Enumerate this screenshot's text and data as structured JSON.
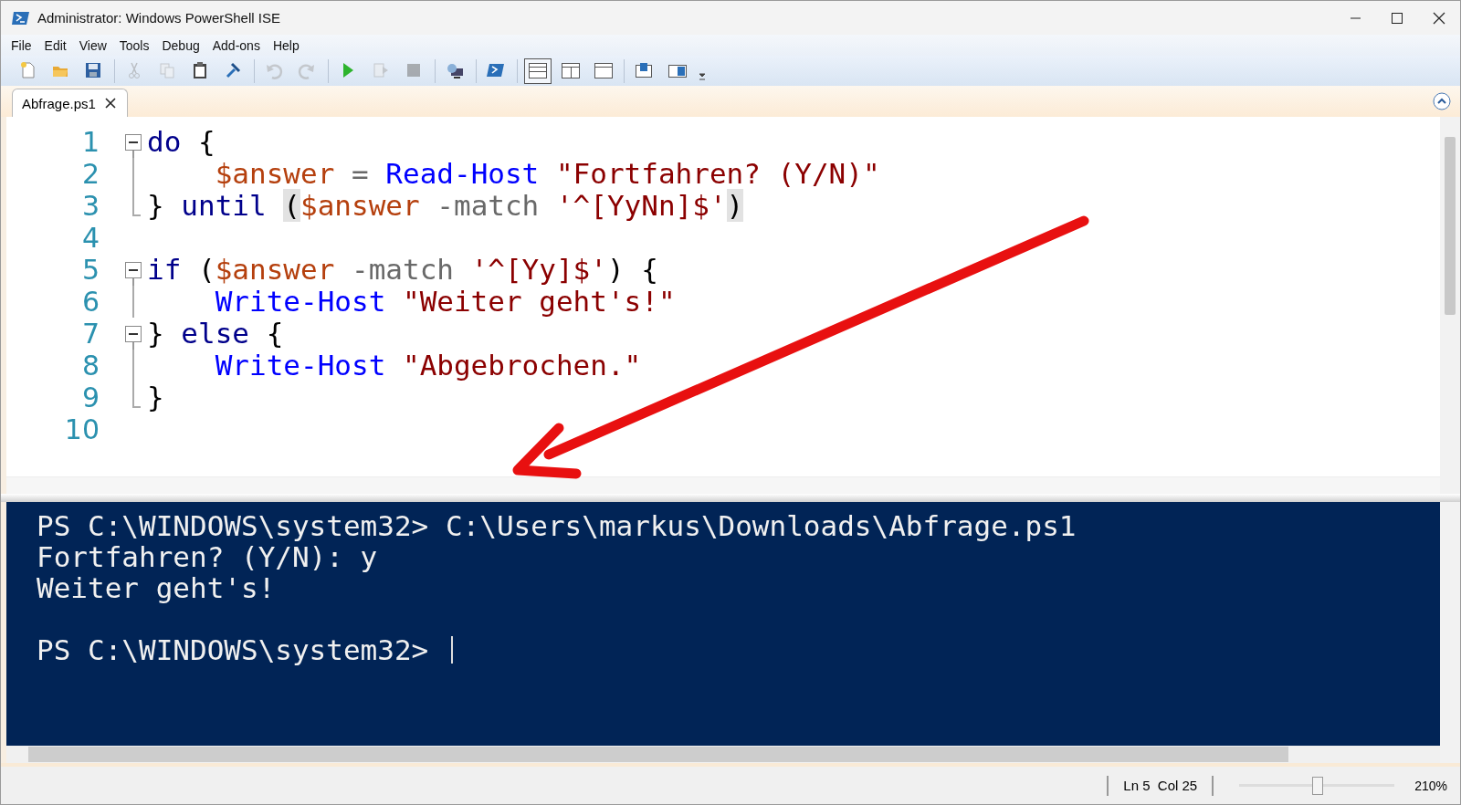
{
  "window": {
    "title": "Administrator: Windows PowerShell ISE"
  },
  "menu": [
    "File",
    "Edit",
    "View",
    "Tools",
    "Debug",
    "Add-ons",
    "Help"
  ],
  "toolbar": [
    {
      "kind": "new",
      "disabled": false
    },
    {
      "kind": "open",
      "disabled": false
    },
    {
      "kind": "save",
      "disabled": false
    },
    {
      "kind": "separator"
    },
    {
      "kind": "cut",
      "disabled": true
    },
    {
      "kind": "copy",
      "disabled": true
    },
    {
      "kind": "paste",
      "disabled": false
    },
    {
      "kind": "clear",
      "disabled": false
    },
    {
      "kind": "separator"
    },
    {
      "kind": "undo",
      "disabled": true
    },
    {
      "kind": "redo",
      "disabled": true
    },
    {
      "kind": "separator"
    },
    {
      "kind": "run",
      "disabled": false
    },
    {
      "kind": "run-selection",
      "disabled": true
    },
    {
      "kind": "stop",
      "disabled": true
    },
    {
      "kind": "separator"
    },
    {
      "kind": "remote",
      "disabled": false
    },
    {
      "kind": "separator"
    },
    {
      "kind": "powershell",
      "disabled": false
    },
    {
      "kind": "separator"
    },
    {
      "kind": "layout-top",
      "disabled": false,
      "selected": true
    },
    {
      "kind": "layout-right",
      "disabled": false,
      "selected": false
    },
    {
      "kind": "layout-max",
      "disabled": false,
      "selected": false
    },
    {
      "kind": "separator"
    },
    {
      "kind": "show-script",
      "disabled": false
    },
    {
      "kind": "show-console",
      "disabled": false
    }
  ],
  "tabs": [
    {
      "label": "Abfrage.ps1",
      "selected": true
    }
  ],
  "editor": {
    "lines": [
      {
        "number": "1",
        "kind": "start",
        "tokens": [
          {
            "text": "do",
            "kind": "kw"
          },
          {
            "text": " {",
            "kind": "plain"
          }
        ]
      },
      {
        "number": "2",
        "kind": "body",
        "tokens": [
          {
            "text": "    $answer",
            "kind": "var"
          },
          {
            "text": " = ",
            "kind": "op"
          },
          {
            "text": "Read-Host ",
            "kind": "cmd"
          },
          {
            "text": "\"Fortfahren? (Y/N)\"",
            "kind": "str"
          }
        ]
      },
      {
        "number": "3",
        "kind": "end",
        "tokens": [
          {
            "text": "} ",
            "kind": "plain"
          },
          {
            "text": "until ",
            "kind": "kw"
          },
          {
            "text": "(",
            "kind": "plain",
            "highlight": true
          },
          {
            "text": "$answer",
            "kind": "var"
          },
          {
            "text": " -match ",
            "kind": "op"
          },
          {
            "text": "'^[YyNn]$'",
            "kind": "str"
          },
          {
            "text": ")",
            "kind": "plain",
            "highlight": true
          }
        ]
      },
      {
        "number": "4",
        "kind": "plain"
      },
      {
        "number": "5",
        "kind": "start",
        "tokens": [
          {
            "text": "if",
            "kind": "kw"
          },
          {
            "text": " (",
            "kind": "plain"
          },
          {
            "text": "$answer",
            "kind": "var"
          },
          {
            "text": " -match ",
            "kind": "op"
          },
          {
            "text": "'^[Yy]$'",
            "kind": "str"
          },
          {
            "text": ") {",
            "kind": "plain"
          }
        ]
      },
      {
        "number": "6",
        "kind": "body",
        "tokens": [
          {
            "text": "    Write-Host ",
            "kind": "cmd"
          },
          {
            "text": "\"Weiter geht's!\"",
            "kind": "str"
          }
        ]
      },
      {
        "number": "7",
        "kind": "start",
        "tokens": [
          {
            "text": "} ",
            "kind": "plain"
          },
          {
            "text": "else",
            "kind": "kw"
          },
          {
            "text": " {",
            "kind": "plain"
          }
        ]
      },
      {
        "number": "8",
        "kind": "body",
        "tokens": [
          {
            "text": "    Write-Host ",
            "kind": "cmd"
          },
          {
            "text": "\"Abgebrochen.\"",
            "kind": "str"
          }
        ]
      },
      {
        "number": "9",
        "kind": "end",
        "tokens": [
          {
            "text": "}",
            "kind": "plain"
          }
        ]
      },
      {
        "number": "10",
        "kind": "plain"
      }
    ]
  },
  "console": {
    "blocks": [
      [
        "PS C:\\WINDOWS\\system32> C:\\Users\\markus\\Downloads\\Abfrage.ps1",
        "Fortfahren? (Y/N): y",
        "Weiter geht's!"
      ],
      [
        "PS C:\\WINDOWS\\system32> "
      ]
    ]
  },
  "status_bar": {
    "position": "Ln 5  Col 25",
    "zoom": {
      "level": 0.5
    },
    "zoom_text": "210%"
  }
}
